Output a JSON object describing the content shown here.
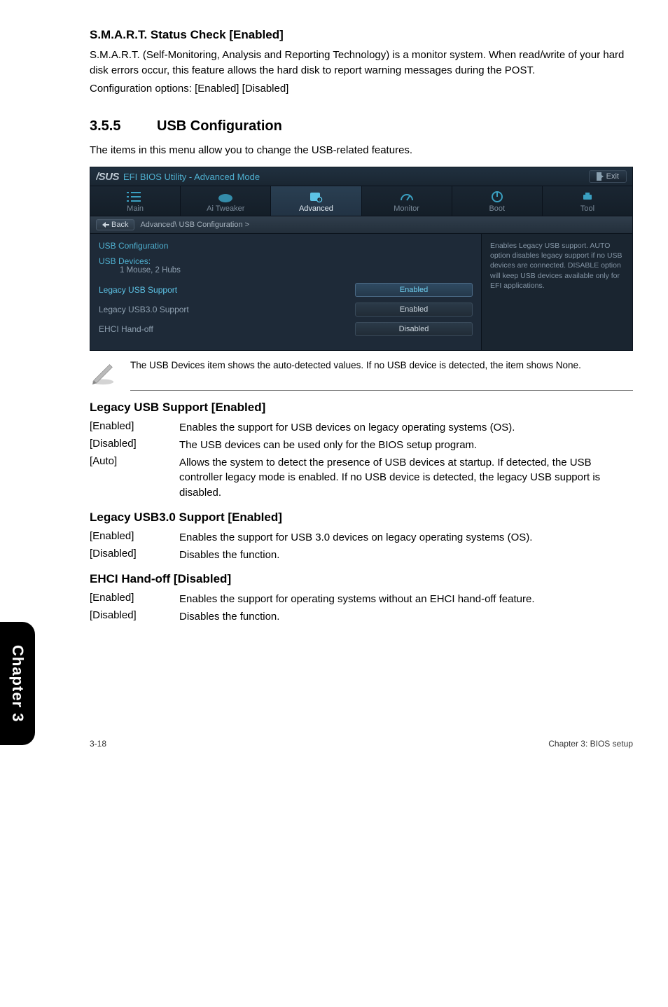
{
  "sect1": {
    "heading": "S.M.A.R.T. Status Check [Enabled]",
    "p1": "S.M.A.R.T. (Self-Monitoring, Analysis and Reporting Technology) is a monitor system. When read/write of your hard disk errors occur, this feature allows the hard disk to report warning messages during the POST.",
    "p2": "Configuration options: [Enabled] [Disabled]"
  },
  "sect2": {
    "num": "3.5.5",
    "title": "USB Configuration",
    "intro": "The items in this menu allow you to change the USB-related features."
  },
  "bios": {
    "logo": "/SUS",
    "title": "EFI BIOS Utility - Advanced Mode",
    "exit": "Exit",
    "tabs": {
      "main": "Main",
      "ai": "Ai  Tweaker",
      "advanced": "Advanced",
      "monitor": "Monitor",
      "boot": "Boot",
      "tool": "Tool"
    },
    "back": "Back",
    "breadcrumb": "Advanced\\  USB Configuration  >",
    "cfg_title": "USB Configuration",
    "usb_devices_label": "USB Devices:",
    "usb_devices_value": "1 Mouse, 2 Hubs",
    "rows": {
      "legacy": {
        "label": "Legacy USB Support",
        "value": "Enabled"
      },
      "legacy30": {
        "label": "Legacy USB3.0 Support",
        "value": "Enabled"
      },
      "ehci": {
        "label": "EHCI Hand-off",
        "value": "Disabled"
      }
    },
    "side": "Enables Legacy USB support. AUTO option disables legacy support if no USB devices are connected. DISABLE option will keep USB devices available only for EFI applications."
  },
  "note": "The USB Devices item shows the auto-detected values. If no USB device is detected, the item shows None.",
  "legacy_usb": {
    "heading": "Legacy USB Support [Enabled]",
    "enabled": "Enables the support for USB devices on legacy operating systems (OS).",
    "disabled": "The USB devices can be used only for the BIOS setup program.",
    "auto": "Allows the system to detect the presence of USB devices at startup. If detected, the USB controller legacy mode is enabled. If no USB device is detected, the legacy USB support is disabled."
  },
  "legacy_usb30": {
    "heading": "Legacy USB3.0 Support [Enabled]",
    "enabled": "Enables the support for USB 3.0 devices on legacy operating systems (OS).",
    "disabled": "Disables the function."
  },
  "ehci": {
    "heading": "EHCI Hand-off [Disabled]",
    "enabled": "Enables the support for operating systems without an EHCI hand-off feature.",
    "disabled": "Disables the function."
  },
  "labels": {
    "enabled": "[Enabled]",
    "disabled": "[Disabled]",
    "auto": "[Auto]"
  },
  "chapter_tab": "Chapter 3",
  "footer": {
    "left": "3-18",
    "right": "Chapter 3: BIOS setup"
  }
}
